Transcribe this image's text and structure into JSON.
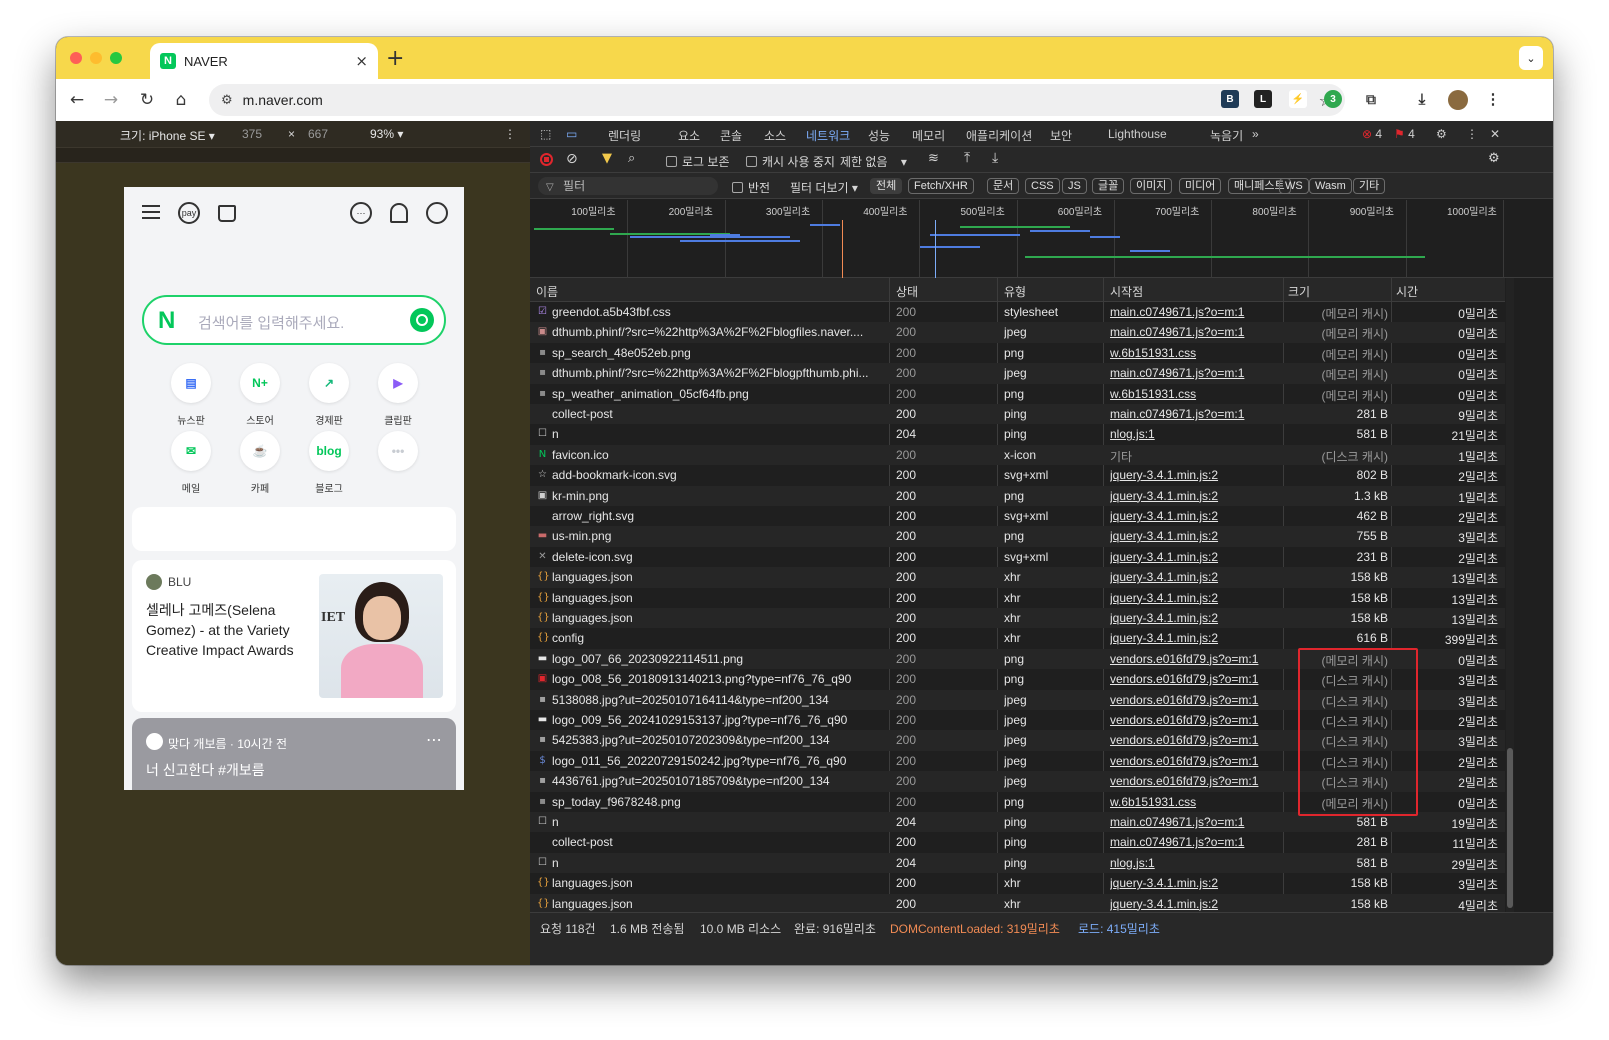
{
  "browser": {
    "tab_title": "NAVER",
    "tab_favicon": "N",
    "url": "m.naver.com",
    "new_tab": "+",
    "close": "×"
  },
  "device_toolbar": {
    "device": "크기: iPhone SE ▾",
    "width": "375",
    "x": "×",
    "height": "667",
    "zoom": "93% ▾",
    "more": "⋮"
  },
  "phone": {
    "search_placeholder": "검색어를 입력해주세요.",
    "search_logo": "N",
    "pay_label": "pay",
    "services": [
      {
        "label": "뉴스판",
        "icon": "news-icon",
        "color": "#3b6ff5",
        "glyph": "▤"
      },
      {
        "label": "스토어",
        "icon": "store-icon",
        "color": "#03c75a",
        "glyph": "N+"
      },
      {
        "label": "경제판",
        "icon": "economy-icon",
        "color": "#14b87a",
        "glyph": "↗"
      },
      {
        "label": "클립판",
        "icon": "clip-icon",
        "color": "#8b5cf6",
        "glyph": "▶"
      },
      {
        "label": "메일",
        "icon": "mail-icon",
        "color": "#03c75a",
        "glyph": "✉"
      },
      {
        "label": "카페",
        "icon": "cafe-icon",
        "color": "#03c75a",
        "glyph": "☕"
      },
      {
        "label": "블로그",
        "icon": "blog-icon",
        "color": "#03c75a",
        "glyph": "blog"
      },
      {
        "label": "",
        "icon": "more-icon",
        "color": "#c8ccd2",
        "glyph": "•••"
      }
    ],
    "news_source": "BLU",
    "news_text": "셀레나 고메즈(Selena Gomez) - at the Variety Creative Impact Awards",
    "feed_author": "맞다 개보름 · 10시간 전",
    "feed_text": "너 신고한다 #개보름",
    "feed_more": "⋯"
  },
  "devtools": {
    "tabs": [
      "렌더링",
      "요소",
      "콘솔",
      "소스",
      "네트워크",
      "성능",
      "메모리",
      "애플리케이션",
      "보안",
      "Lighthouse",
      "녹음기"
    ],
    "more_tabs": "»",
    "errors": "4",
    "issues": "4",
    "toolbar": {
      "preserve_log": "로그 보존",
      "disable_cache": "캐시 사용 중지",
      "throttle": "제한 없음"
    },
    "filter": {
      "placeholder": "필터",
      "invert": "반전",
      "more_filters": "필터 더보기 ▾",
      "chips": [
        "전체",
        "Fetch/XHR",
        "문서",
        "CSS",
        "JS",
        "글꼴",
        "이미지",
        "미디어",
        "매니페스트",
        "WS",
        "Wasm",
        "기타"
      ]
    },
    "overview_ticks": [
      "100밀리초",
      "200밀리초",
      "300밀리초",
      "400밀리초",
      "500밀리초",
      "600밀리초",
      "700밀리초",
      "800밀리초",
      "900밀리초",
      "1000밀리초"
    ],
    "columns": [
      "이름",
      "상태",
      "유형",
      "시작점",
      "크기",
      "시간"
    ],
    "rows": [
      {
        "name": "greendot.a5b43fbf.css",
        "status": "200",
        "type": "stylesheet",
        "initiator": "main.c0749671.js?o=m:1",
        "size": "(메모리 캐시)",
        "time": "0밀리초",
        "icon": "☑",
        "icolor": "#b58cf2",
        "cached": true
      },
      {
        "name": "dthumb.phinf/?src=%22http%3A%2F%2Fblogfiles.naver....",
        "status": "200",
        "type": "jpeg",
        "initiator": "main.c0749671.js?o=m:1",
        "size": "(메모리 캐시)",
        "time": "0밀리초",
        "icon": "▣",
        "icolor": "#c98a8a",
        "cached": true
      },
      {
        "name": "sp_search_48e052eb.png",
        "status": "200",
        "type": "png",
        "initiator": "w.6b151931.css",
        "size": "(메모리 캐시)",
        "time": "0밀리초",
        "icon": "▪",
        "icolor": "#8a8a8a",
        "cached": true
      },
      {
        "name": "dthumb.phinf/?src=%22http%3A%2F%2Fblogpfthumb.phi...",
        "status": "200",
        "type": "jpeg",
        "initiator": "main.c0749671.js?o=m:1",
        "size": "(메모리 캐시)",
        "time": "0밀리초",
        "icon": "▪",
        "icolor": "#8a8a8a",
        "cached": true
      },
      {
        "name": "sp_weather_animation_05cf64fb.png",
        "status": "200",
        "type": "png",
        "initiator": "w.6b151931.css",
        "size": "(메모리 캐시)",
        "time": "0밀리초",
        "icon": "▪",
        "icolor": "#8a8a8a",
        "cached": true
      },
      {
        "name": "collect-post",
        "status": "200",
        "type": "ping",
        "initiator": "main.c0749671.js?o=m:1",
        "size": "281 B",
        "time": "9밀리초",
        "icon": "",
        "icolor": "#8a8a8a",
        "cached": false
      },
      {
        "name": "n",
        "status": "204",
        "type": "ping",
        "initiator": "nlog.js:1",
        "size": "581 B",
        "time": "21밀리초",
        "icon": "☐",
        "icolor": "#cfcfcf",
        "cached": false
      },
      {
        "name": "favicon.ico",
        "status": "200",
        "type": "x-icon",
        "initiator": "기타",
        "size": "(디스크 캐시)",
        "time": "1밀리초",
        "icon": "N",
        "icolor": "#03c75a",
        "cached": true,
        "plain_init": true
      },
      {
        "name": "add-bookmark-icon.svg",
        "status": "200",
        "type": "svg+xml",
        "initiator": "jquery-3.4.1.min.js:2",
        "size": "802 B",
        "time": "2밀리초",
        "icon": "☆",
        "icolor": "#cfcfcf",
        "cached": false
      },
      {
        "name": "kr-min.png",
        "status": "200",
        "type": "png",
        "initiator": "jquery-3.4.1.min.js:2",
        "size": "1.3 kB",
        "time": "1밀리초",
        "icon": "▣",
        "icolor": "#d0d0d0",
        "cached": false
      },
      {
        "name": "arrow_right.svg",
        "status": "200",
        "type": "svg+xml",
        "initiator": "jquery-3.4.1.min.js:2",
        "size": "462 B",
        "time": "2밀리초",
        "icon": "",
        "icolor": "#8a8a8a",
        "cached": false
      },
      {
        "name": "us-min.png",
        "status": "200",
        "type": "png",
        "initiator": "jquery-3.4.1.min.js:2",
        "size": "755 B",
        "time": "3밀리초",
        "icon": "▬",
        "icolor": "#c96a6a",
        "cached": false
      },
      {
        "name": "delete-icon.svg",
        "status": "200",
        "type": "svg+xml",
        "initiator": "jquery-3.4.1.min.js:2",
        "size": "231 B",
        "time": "2밀리초",
        "icon": "✕",
        "icolor": "#9a9a9a",
        "cached": false
      },
      {
        "name": "languages.json",
        "status": "200",
        "type": "xhr",
        "initiator": "jquery-3.4.1.min.js:2",
        "size": "158 kB",
        "time": "13밀리초",
        "icon": "{}",
        "icolor": "#e8a13c",
        "cached": false
      },
      {
        "name": "languages.json",
        "status": "200",
        "type": "xhr",
        "initiator": "jquery-3.4.1.min.js:2",
        "size": "158 kB",
        "time": "13밀리초",
        "icon": "{}",
        "icolor": "#e8a13c",
        "cached": false
      },
      {
        "name": "languages.json",
        "status": "200",
        "type": "xhr",
        "initiator": "jquery-3.4.1.min.js:2",
        "size": "158 kB",
        "time": "13밀리초",
        "icon": "{}",
        "icolor": "#e8a13c",
        "cached": false
      },
      {
        "name": "config",
        "status": "200",
        "type": "xhr",
        "initiator": "jquery-3.4.1.min.js:2",
        "size": "616 B",
        "time": "399밀리초",
        "icon": "{}",
        "icolor": "#e8a13c",
        "cached": false
      },
      {
        "name": "logo_007_66_20230922114511.png",
        "status": "200",
        "type": "png",
        "initiator": "vendors.e016fd79.js?o=m:1",
        "size": "(메모리 캐시)",
        "time": "0밀리초",
        "icon": "▬",
        "icolor": "#e6e6e6",
        "cached": true
      },
      {
        "name": "logo_008_56_20180913140213.png?type=nf76_76_q90",
        "status": "200",
        "type": "png",
        "initiator": "vendors.e016fd79.js?o=m:1",
        "size": "(디스크 캐시)",
        "time": "3밀리초",
        "icon": "▣",
        "icolor": "#e0262d",
        "cached": true
      },
      {
        "name": "5138088.jpg?ut=20250107164114&type=nf200_134",
        "status": "200",
        "type": "jpeg",
        "initiator": "vendors.e016fd79.js?o=m:1",
        "size": "(디스크 캐시)",
        "time": "3밀리초",
        "icon": "▪",
        "icolor": "#a0a0a0",
        "cached": true
      },
      {
        "name": "logo_009_56_20241029153137.jpg?type=nf76_76_q90",
        "status": "200",
        "type": "jpeg",
        "initiator": "vendors.e016fd79.js?o=m:1",
        "size": "(디스크 캐시)",
        "time": "2밀리초",
        "icon": "▬",
        "icolor": "#e6e6e6",
        "cached": true
      },
      {
        "name": "5425383.jpg?ut=20250107202309&type=nf200_134",
        "status": "200",
        "type": "jpeg",
        "initiator": "vendors.e016fd79.js?o=m:1",
        "size": "(디스크 캐시)",
        "time": "3밀리초",
        "icon": "▪",
        "icolor": "#a0a0a0",
        "cached": true
      },
      {
        "name": "logo_011_56_20220729150242.jpg?type=nf76_76_q90",
        "status": "200",
        "type": "jpeg",
        "initiator": "vendors.e016fd79.js?o=m:1",
        "size": "(디스크 캐시)",
        "time": "2밀리초",
        "icon": "$",
        "icolor": "#6a8ad8",
        "cached": true
      },
      {
        "name": "4436761.jpg?ut=20250107185709&type=nf200_134",
        "status": "200",
        "type": "jpeg",
        "initiator": "vendors.e016fd79.js?o=m:1",
        "size": "(디스크 캐시)",
        "time": "2밀리초",
        "icon": "▪",
        "icolor": "#a0a0a0",
        "cached": true
      },
      {
        "name": "sp_today_f9678248.png",
        "status": "200",
        "type": "png",
        "initiator": "w.6b151931.css",
        "size": "(메모리 캐시)",
        "time": "0밀리초",
        "icon": "▪",
        "icolor": "#8a8a8a",
        "cached": true
      },
      {
        "name": "n",
        "status": "204",
        "type": "ping",
        "initiator": "main.c0749671.js?o=m:1",
        "size": "581 B",
        "time": "19밀리초",
        "icon": "☐",
        "icolor": "#cfcfcf",
        "cached": false
      },
      {
        "name": "collect-post",
        "status": "200",
        "type": "ping",
        "initiator": "main.c0749671.js?o=m:1",
        "size": "281 B",
        "time": "11밀리초",
        "icon": "",
        "icolor": "#8a8a8a",
        "cached": false
      },
      {
        "name": "n",
        "status": "204",
        "type": "ping",
        "initiator": "nlog.js:1",
        "size": "581 B",
        "time": "29밀리초",
        "icon": "☐",
        "icolor": "#cfcfcf",
        "cached": false
      },
      {
        "name": "languages.json",
        "status": "200",
        "type": "xhr",
        "initiator": "jquery-3.4.1.min.js:2",
        "size": "158 kB",
        "time": "3밀리초",
        "icon": "{}",
        "icolor": "#e8a13c",
        "cached": false
      },
      {
        "name": "languages.json",
        "status": "200",
        "type": "xhr",
        "initiator": "jquery-3.4.1.min.js:2",
        "size": "158 kB",
        "time": "4밀리초",
        "icon": "{}",
        "icolor": "#e8a13c",
        "cached": false
      }
    ],
    "status_bar": {
      "requests": "요청 118건",
      "transferred": "1.6 MB 전송됨",
      "resources": "10.0 MB 리소스",
      "finish": "완료: 916밀리초",
      "dcl": "DOMContentLoaded: 319밀리초",
      "load": "로드: 415밀리초"
    },
    "colors": {
      "active_tab": "#7cacf8",
      "dcl": "#f28b54",
      "load": "#7cacf8",
      "highlight": "#e0262d"
    }
  }
}
